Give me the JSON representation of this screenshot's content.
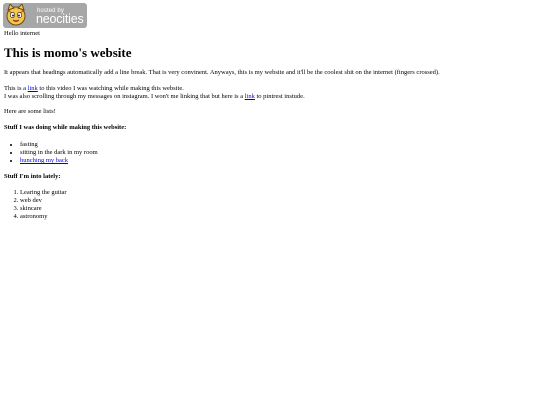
{
  "badge": {
    "hosted_text": "hosted by",
    "brand_text": "neocities"
  },
  "greeting": "Hello internet",
  "title": "This is momo's website",
  "intro": "It appears that headings automatically add a line break. That is very convinent. Anyways, this is my website and it'll be the coolest shit on the internet (fingers crossed).",
  "video_line": {
    "before": "This is a ",
    "link": "link",
    "after": " to this video I was watching while making this website."
  },
  "pinterest_line": {
    "before": "I was also scrolling through my messages on instagram. I won't me linking that but here is a ",
    "link": "link",
    "after": " to pintrest instude."
  },
  "lists_intro": "Here are some lists!",
  "making_section": {
    "heading": "Stuff I was doing while making this website:",
    "items": [
      "fasting",
      "sitting in the dark in my room",
      "hunching my back"
    ]
  },
  "into_section": {
    "heading": "Stuff I'm into lately:",
    "items": [
      "Learing the guitar",
      "web dev",
      "skincare",
      "astronomy"
    ]
  },
  "colors": {
    "link": "#0000ee",
    "badge_bg": "#a7a7a7"
  }
}
